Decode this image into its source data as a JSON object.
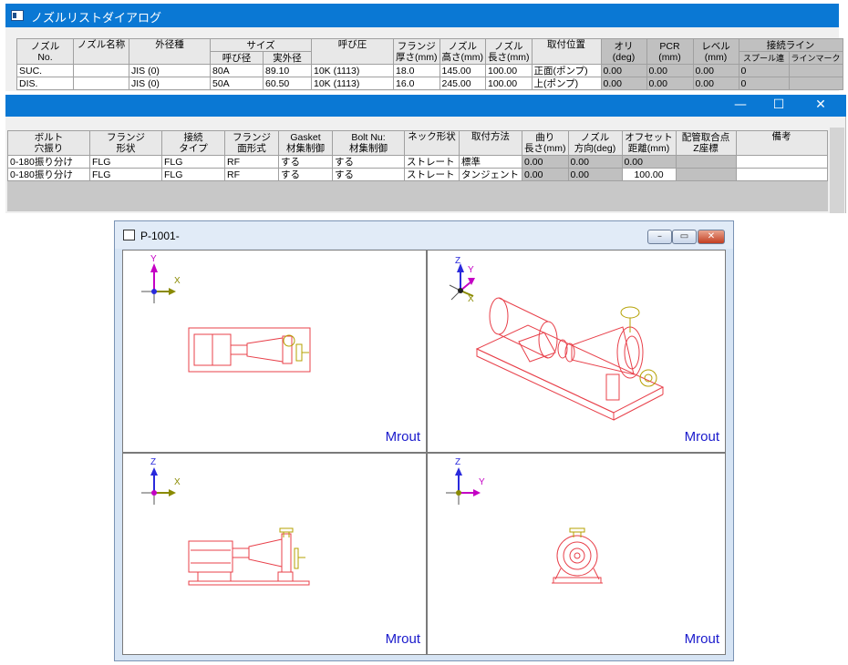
{
  "nozzle_dialog": {
    "title": "ノズルリストダイアログ",
    "upper_table": {
      "headers": {
        "nozzle_no": "ノズル\nNo.",
        "nozzle_name": "ノズル名称",
        "outer_dia_type": "外径種",
        "size": "サイズ",
        "size_nominal": "呼び径",
        "size_actual": "実外径",
        "pressure": "呼び圧",
        "flange_thickness": "フランジ\n厚さ(mm)",
        "nozzle_height": "ノズル\n高さ(mm)",
        "nozzle_length": "ノズル\n長さ(mm)",
        "mount_position": "取付位置",
        "ori": "オリ\n(deg)",
        "pcr": "PCR\n(mm)",
        "level": "レベル\n(mm)",
        "connect_line": "接続ライン",
        "spool_link": "スプール連",
        "line_mark": "ラインマーク"
      },
      "rows": [
        {
          "no": "SUC.",
          "name": "",
          "type": "JIS (0)",
          "nominal": "80A",
          "actual": "89.10",
          "pressure": "10K (1113)",
          "flange": "18.0",
          "height": "145.00",
          "length": "100.00",
          "position": "正面(ポンプ)",
          "ori": "0.00",
          "pcr": "0.00",
          "level": "0.00",
          "spool": "0",
          "line": ""
        },
        {
          "no": "DIS.",
          "name": "",
          "type": "JIS (0)",
          "nominal": "50A",
          "actual": "60.50",
          "pressure": "10K (1113)",
          "flange": "16.0",
          "height": "245.00",
          "length": "100.00",
          "position": "上(ポンプ)",
          "ori": "0.00",
          "pcr": "0.00",
          "level": "0.00",
          "spool": "0",
          "line": ""
        }
      ]
    },
    "window_controls": {
      "minimize": "—",
      "maximize": "☐",
      "close": "✕"
    },
    "lower_table": {
      "headers": {
        "bolt": "ボルト\n穴振り",
        "flange_shape": "フランジ\n形状",
        "connect_type": "接続\nタイプ",
        "flange_face": "フランジ\n面形式",
        "gasket": "Gasket\n材集制御",
        "bolt_nut": "Bolt Nu:\n材集制御",
        "neck_shape": "ネック形状",
        "mount_method": "取付方法",
        "bend_length": "曲り\n長さ(mm)",
        "nozzle_dir": "ノズル\n方向(deg)",
        "offset": "オフセット\n距離(mm)",
        "pipe_point": "配管取合点\nZ座標",
        "remarks": "備考"
      },
      "rows": [
        {
          "bolt": "0-180振り分け",
          "shape": "FLG",
          "ctype": "FLG",
          "face": "RF",
          "gasket": "する",
          "boltnut": "する",
          "neck": "ストレート",
          "method": "標準",
          "bend": "0.00",
          "dir": "0.00",
          "offset": "0.00",
          "point": "",
          "remarks": ""
        },
        {
          "bolt": "0-180振り分け",
          "shape": "FLG",
          "ctype": "FLG",
          "face": "RF",
          "gasket": "する",
          "boltnut": "する",
          "neck": "ストレート",
          "method": "タンジェント",
          "bend": "0.00",
          "dir": "0.00",
          "offset": "100.00",
          "point": "",
          "remarks": ""
        }
      ]
    }
  },
  "cad_window": {
    "title": "P-1001-",
    "buttons": {
      "minimize": "–",
      "restore": "▭",
      "close": "✕"
    },
    "viewports": [
      {
        "view": "top",
        "axes": [
          "Y",
          "X"
        ],
        "label": "Mrout"
      },
      {
        "view": "iso",
        "axes": [
          "Z",
          "Y",
          "X"
        ],
        "label": "Mrout"
      },
      {
        "view": "front",
        "axes": [
          "Z",
          "X"
        ],
        "label": "Mrout"
      },
      {
        "view": "side",
        "axes": [
          "Z",
          "Y"
        ],
        "label": "Mrout"
      }
    ]
  },
  "colors": {
    "title_blue": "#0a78d4",
    "model_red": "#e8404a",
    "valve_olive": "#b4a000",
    "axis_magenta": "#c400c4",
    "axis_olive": "#8a8a00",
    "axis_blue": "#2a2adc",
    "label_blue": "#1a1acc"
  }
}
